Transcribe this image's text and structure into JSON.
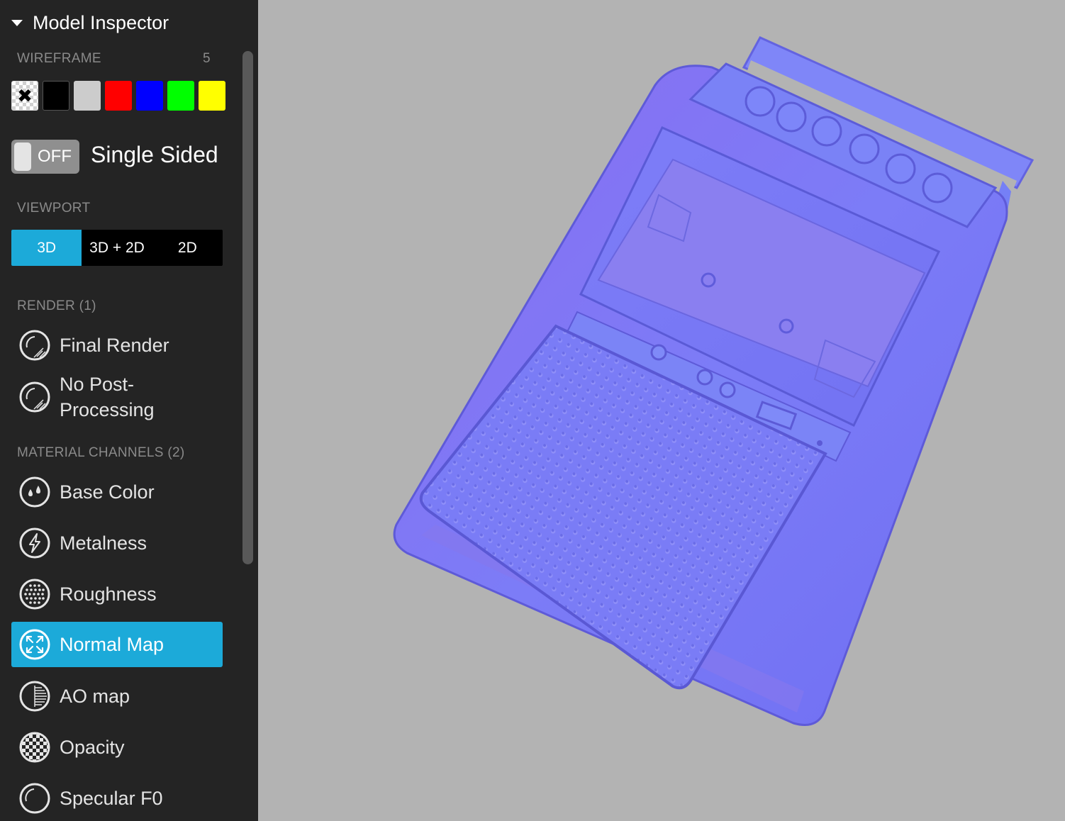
{
  "sidebar": {
    "title": "Model Inspector",
    "wireframe": {
      "label": "WIREFRAME",
      "count": "5",
      "colors": [
        "none",
        "#000000",
        "#cccccc",
        "#ff0000",
        "#0000ff",
        "#00ff00",
        "#ffff00"
      ],
      "none_glyph": "✖"
    },
    "single_sided": {
      "state": "OFF",
      "label": "Single Sided"
    },
    "viewport": {
      "label": "VIEWPORT",
      "options": [
        "3D",
        "3D + 2D",
        "2D"
      ],
      "selected": "3D"
    },
    "render": {
      "label": "RENDER (1)",
      "items": [
        {
          "label": "Final Render",
          "icon": "render-icon"
        },
        {
          "label": "No Post-Processing",
          "icon": "render-icon"
        }
      ]
    },
    "material_channels": {
      "label": "MATERIAL CHANNELS (2)",
      "items": [
        {
          "label": "Base Color",
          "icon": "drops-icon"
        },
        {
          "label": "Metalness",
          "icon": "lightning-icon"
        },
        {
          "label": "Roughness",
          "icon": "dots-icon"
        },
        {
          "label": "Normal Map",
          "icon": "arrows-icon",
          "selected": true
        },
        {
          "label": "AO map",
          "icon": "half-circle-icon"
        },
        {
          "label": "Opacity",
          "icon": "checker-icon"
        },
        {
          "label": "Specular F0",
          "icon": "circle-icon"
        }
      ]
    }
  },
  "colors": {
    "accent": "#1caad9",
    "sidebar_bg": "#242424",
    "viewport_bg": "#b3b3b3"
  },
  "viewport_model": {
    "description_icon": "cassette-recorder-normal-map"
  }
}
